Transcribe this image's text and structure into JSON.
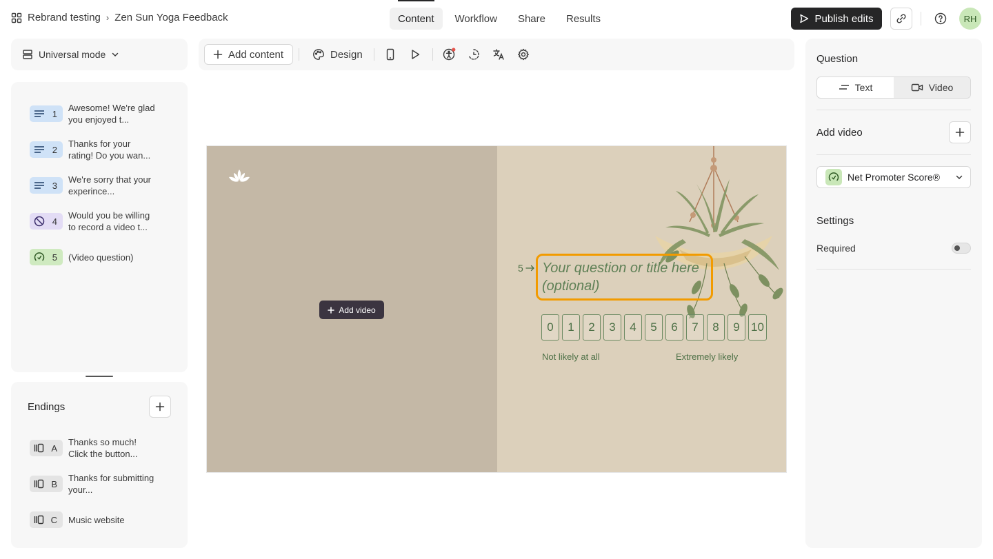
{
  "breadcrumb": {
    "workspace": "Rebrand testing",
    "separator": "›",
    "form_title": "Zen Sun Yoga Feedback"
  },
  "tabs": [
    "Content",
    "Workflow",
    "Share",
    "Results"
  ],
  "active_tab": "Content",
  "header": {
    "publish_label": "Publish edits",
    "avatar_initials": "RH"
  },
  "mode_selector": {
    "label": "Universal mode"
  },
  "questions": [
    {
      "num": "1",
      "text": "Awesome! We're glad you enjoyed t...",
      "type": "text",
      "color": "#cfe2f7"
    },
    {
      "num": "2",
      "text": "Thanks for your rating! Do you wan...",
      "type": "text",
      "color": "#cfe2f7"
    },
    {
      "num": "3",
      "text": "We're sorry that your experince...",
      "type": "text",
      "color": "#cfe2f7"
    },
    {
      "num": "4",
      "text": "Would you be willing to record a video t...",
      "type": "no-icon",
      "color": "#e3dcf5"
    },
    {
      "num": "5",
      "text": "(Video question)",
      "type": "gauge",
      "color": "#cfeac0"
    }
  ],
  "endings": {
    "title": "Endings",
    "items": [
      {
        "letter": "A",
        "text": "Thanks so much! Click the button..."
      },
      {
        "letter": "B",
        "text": "Thanks for submitting your..."
      },
      {
        "letter": "C",
        "text": "Music website"
      }
    ]
  },
  "toolbar": {
    "add_content_label": "Add content",
    "design_label": "Design"
  },
  "canvas": {
    "add_video_label": "Add video",
    "question_number": "5",
    "question_placeholder": "Your question or title here (optional)",
    "scale": [
      "0",
      "1",
      "2",
      "3",
      "4",
      "5",
      "6",
      "7",
      "8",
      "9",
      "10"
    ],
    "low_label": "Not likely at all",
    "high_label": "Extremely likely",
    "accent_color": "#f29b00",
    "text_color": "#5f8056"
  },
  "right_panel": {
    "question_heading": "Question",
    "text_option": "Text",
    "video_option": "Video",
    "selected_option": "Video",
    "add_video_label": "Add video",
    "question_type": "Net Promoter Score®",
    "settings_heading": "Settings",
    "required_label": "Required",
    "required_on": false
  }
}
